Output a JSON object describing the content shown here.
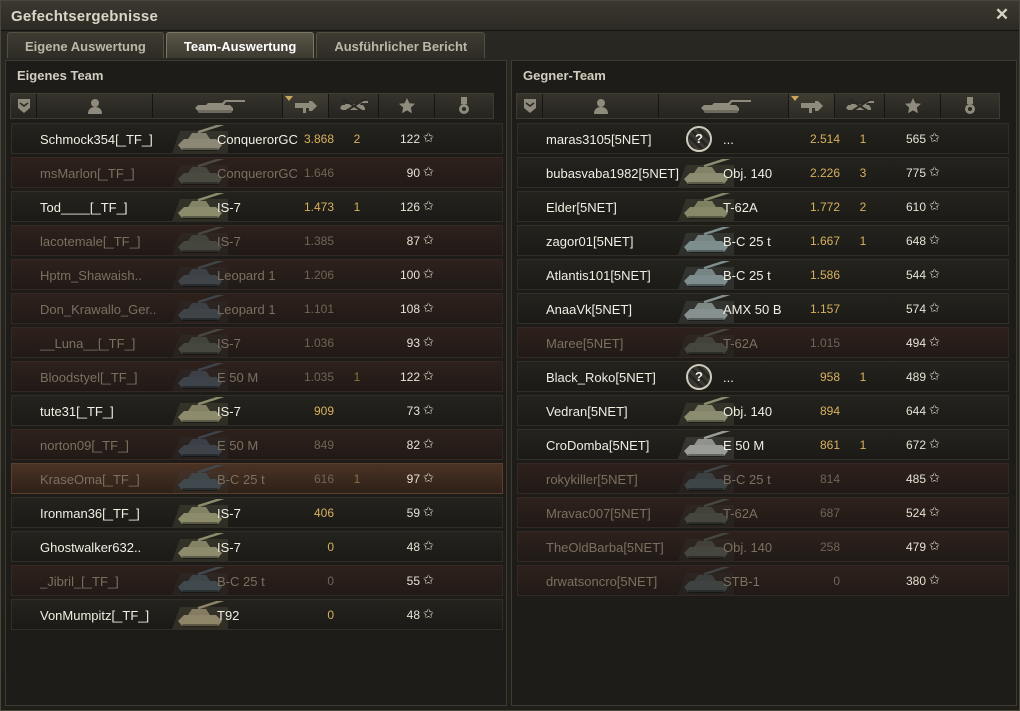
{
  "window": {
    "title": "Gefechtsergebnisse",
    "close_label": "✕"
  },
  "tabs": [
    {
      "label": "Eigene Auswertung",
      "active": false
    },
    {
      "label": "Team-Auswertung",
      "active": true
    },
    {
      "label": "Ausführlicher Bericht",
      "active": false
    }
  ],
  "colors": {
    "accent": "#d7b15e",
    "dead_row": "#2e211c",
    "highlight_row": "#4a3324"
  },
  "columns": [
    "squad-icon",
    "player-icon",
    "tank-icon",
    "damage-icon",
    "kills-icon",
    "xp-icon",
    "medal-icon"
  ],
  "sorted_column": "damage",
  "left": {
    "name": "Eigenes Team",
    "rows": [
      {
        "player": "Schmock354[_TF_]",
        "tank": "ConquerorGC",
        "damage": "3.868",
        "kills": "2",
        "xp": "122",
        "state": "alive",
        "tank_color": "#8d8875",
        "unknown": false
      },
      {
        "player": "msMarlon[_TF_]",
        "tank": "ConquerorGC",
        "damage": "1.646",
        "kills": "",
        "xp": "90",
        "state": "dead",
        "tank_color": "#4b4a41",
        "unknown": false
      },
      {
        "player": "Tod____[_TF_]",
        "tank": "IS-7",
        "damage": "1.473",
        "kills": "1",
        "xp": "126",
        "state": "alive",
        "tank_color": "#8c8b6c",
        "unknown": false
      },
      {
        "player": "lacotemale[_TF_]",
        "tank": "IS-7",
        "damage": "1.385",
        "kills": "",
        "xp": "87",
        "state": "dead",
        "tank_color": "#45473e",
        "unknown": false
      },
      {
        "player": "Hptm_Shawaish..",
        "tank": "Leopard 1",
        "damage": "1.206",
        "kills": "",
        "xp": "100",
        "state": "dead",
        "tank_color": "#3f4448",
        "unknown": false
      },
      {
        "player": "Don_Krawallo_Ger..",
        "tank": "Leopard 1",
        "damage": "1.101",
        "kills": "",
        "xp": "108",
        "state": "dead",
        "tank_color": "#3f4448",
        "unknown": false
      },
      {
        "player": "__Luna__[_TF_]",
        "tank": "IS-7",
        "damage": "1.036",
        "kills": "",
        "xp": "93",
        "state": "dead",
        "tank_color": "#45473e",
        "unknown": false
      },
      {
        "player": "Bloodstyel[_TF_]",
        "tank": "E 50 M",
        "damage": "1.035",
        "kills": "1",
        "xp": "122",
        "state": "dead",
        "tank_color": "#3e434a",
        "unknown": false
      },
      {
        "player": "tute31[_TF_]",
        "tank": "IS-7",
        "damage": "909",
        "kills": "",
        "xp": "73",
        "state": "alive",
        "tank_color": "#8c8b6c",
        "unknown": false
      },
      {
        "player": "norton09[_TF_]",
        "tank": "E 50 M",
        "damage": "849",
        "kills": "",
        "xp": "82",
        "state": "dead",
        "tank_color": "#3e434a",
        "unknown": false
      },
      {
        "player": "KraseOma[_TF_]",
        "tank": "B-C 25 t",
        "damage": "616",
        "kills": "1",
        "xp": "97",
        "state": "highlight",
        "tank_color": "#404a4e",
        "unknown": false
      },
      {
        "player": "Ironman36[_TF_]",
        "tank": "IS-7",
        "damage": "406",
        "kills": "",
        "xp": "59",
        "state": "alive",
        "tank_color": "#8c8b6c",
        "unknown": false
      },
      {
        "player": "Ghostwalker632..",
        "tank": "IS-7",
        "damage": "0",
        "kills": "",
        "xp": "48",
        "state": "alive",
        "tank_color": "#8c8b6c",
        "unknown": false
      },
      {
        "player": "_Jibril_[_TF_]",
        "tank": "B-C 25 t",
        "damage": "0",
        "kills": "",
        "xp": "55",
        "state": "dead",
        "tank_color": "#404a4e",
        "unknown": false
      },
      {
        "player": "VonMumpitz[_TF_]",
        "tank": "T92",
        "damage": "0",
        "kills": "",
        "xp": "48",
        "state": "alive",
        "tank_color": "#8e8468",
        "unknown": false
      }
    ]
  },
  "right": {
    "name": "Gegner-Team",
    "rows": [
      {
        "player": "maras3105[5NET]",
        "tank": "...",
        "damage": "2.514",
        "kills": "1",
        "xp": "565",
        "state": "alive",
        "tank_color": "#cfcabb",
        "unknown": true
      },
      {
        "player": "bubasvaba1982[5NET]",
        "tank": "Obj. 140",
        "damage": "2.226",
        "kills": "3",
        "xp": "775",
        "state": "alive",
        "tank_color": "#8b8c70",
        "unknown": false
      },
      {
        "player": "Elder[5NET]",
        "tank": "T-62A",
        "damage": "1.772",
        "kills": "2",
        "xp": "610",
        "state": "alive",
        "tank_color": "#878868",
        "unknown": false
      },
      {
        "player": "zagor01[5NET]",
        "tank": "B-C 25 t",
        "damage": "1.667",
        "kills": "1",
        "xp": "648",
        "state": "alive",
        "tank_color": "#7e8e8e",
        "unknown": false
      },
      {
        "player": "Atlantis101[5NET]",
        "tank": "B-C 25 t",
        "damage": "1.586",
        "kills": "",
        "xp": "544",
        "state": "alive",
        "tank_color": "#7e8e8e",
        "unknown": false
      },
      {
        "player": "AnaaVk[5NET]",
        "tank": "AMX 50 B",
        "damage": "1.157",
        "kills": "",
        "xp": "574",
        "state": "alive",
        "tank_color": "#86918f",
        "unknown": false
      },
      {
        "player": "Maree[5NET]",
        "tank": "T-62A",
        "damage": "1.015",
        "kills": "",
        "xp": "494",
        "state": "dead",
        "tank_color": "#45463d",
        "unknown": false
      },
      {
        "player": "Black_Roko[5NET]",
        "tank": "...",
        "damage": "958",
        "kills": "1",
        "xp": "489",
        "state": "alive",
        "tank_color": "#cfcabb",
        "unknown": true
      },
      {
        "player": "Vedran[5NET]",
        "tank": "Obj. 140",
        "damage": "894",
        "kills": "",
        "xp": "644",
        "state": "alive",
        "tank_color": "#8b8c70",
        "unknown": false
      },
      {
        "player": "CroDomba[5NET]",
        "tank": "E 50 M",
        "damage": "861",
        "kills": "1",
        "xp": "672",
        "state": "alive",
        "tank_color": "#9a9c98",
        "unknown": false
      },
      {
        "player": "rokykiller[5NET]",
        "tank": "B-C 25 t",
        "damage": "814",
        "kills": "",
        "xp": "485",
        "state": "dead",
        "tank_color": "#3d4546",
        "unknown": false
      },
      {
        "player": "Mravac007[5NET]",
        "tank": "T-62A",
        "damage": "687",
        "kills": "",
        "xp": "524",
        "state": "dead",
        "tank_color": "#45463d",
        "unknown": false
      },
      {
        "player": "TheOldBarba[5NET]",
        "tank": "Obj. 140",
        "damage": "258",
        "kills": "",
        "xp": "479",
        "state": "dead",
        "tank_color": "#45463d",
        "unknown": false
      },
      {
        "player": "drwatsoncro[5NET]",
        "tank": "STB-1",
        "damage": "0",
        "kills": "",
        "xp": "380",
        "state": "dead",
        "tank_color": "#3e4240",
        "unknown": false
      }
    ]
  }
}
